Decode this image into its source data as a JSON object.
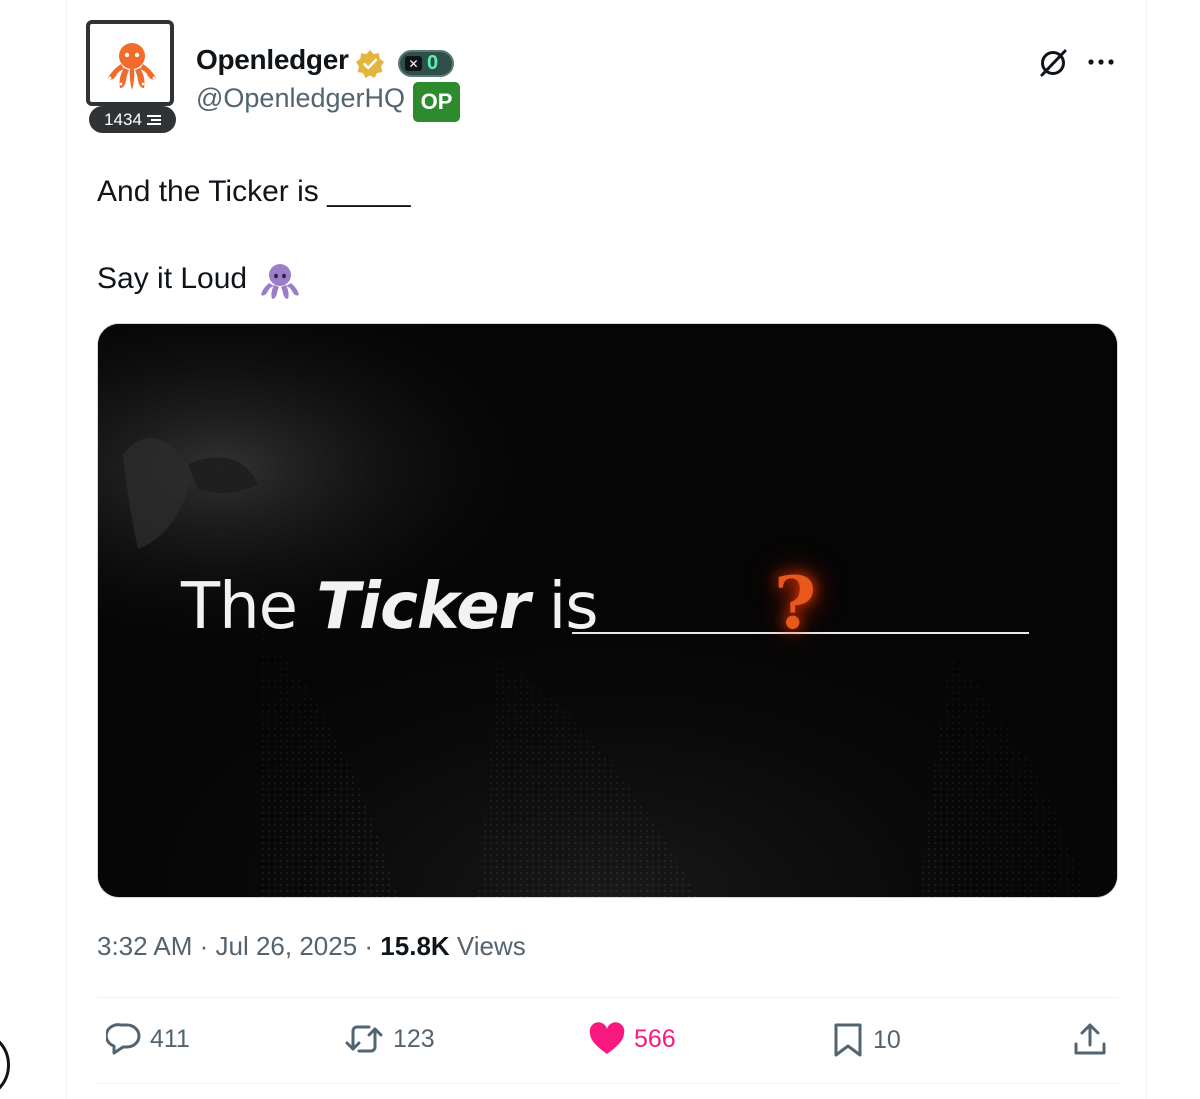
{
  "author": {
    "display_name": "Openledger",
    "handle": "@OpenledgerHQ",
    "avatar_badge_count": "1434",
    "x_badge_count": "0",
    "op_badge": "OP",
    "avatar_icon": "octopus-icon",
    "verified_icon": "verified-gold-badge-icon"
  },
  "tweet": {
    "line1": "And the Ticker is _____",
    "line2": "Say it Loud",
    "emoji": "octopus-emoji-icon"
  },
  "media": {
    "text_prefix": "The ",
    "text_bold": "Ticker",
    "text_suffix": " is",
    "question_mark": "?"
  },
  "meta": {
    "time": "3:32 AM",
    "sep1": " · ",
    "date": "Jul 26, 2025",
    "sep2": " · ",
    "views_count": "15.8K",
    "views_label": " Views"
  },
  "actions": {
    "replies": "411",
    "reposts": "123",
    "likes": "566",
    "bookmarks": "10"
  },
  "colors": {
    "like": "#f91880",
    "secondary_text": "#536471",
    "op_badge_bg": "#2d8a2d",
    "avatar_orange": "#f26b2a",
    "question_orange": "#e8581c"
  }
}
